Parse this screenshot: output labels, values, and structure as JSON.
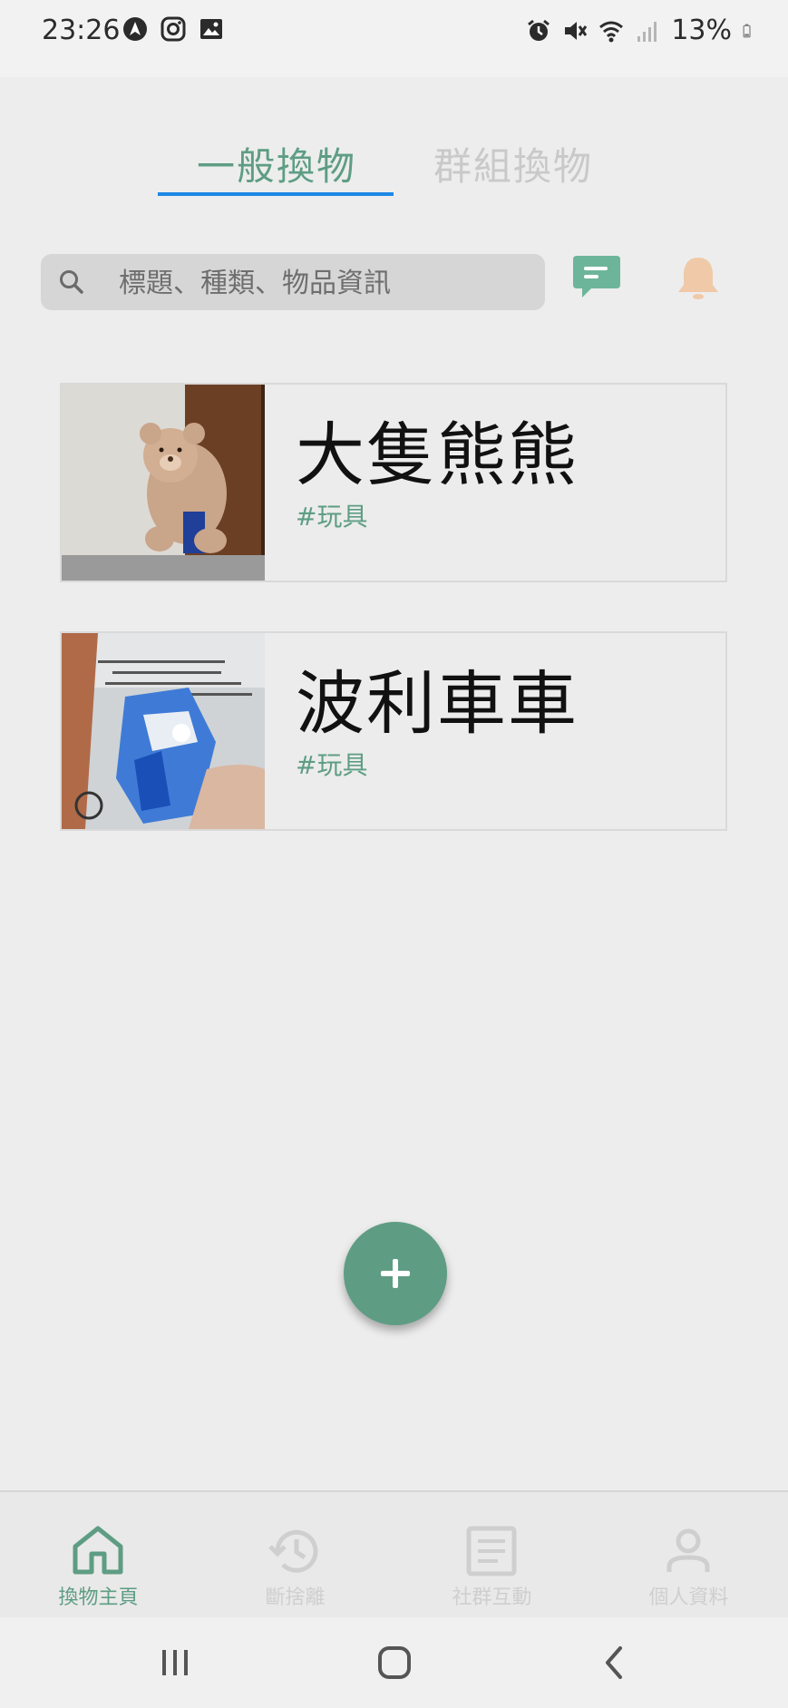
{
  "status": {
    "time": "23:26",
    "battery": "13%",
    "left_icons": [
      "navigation-app-icon",
      "instagram-icon",
      "gallery-icon"
    ],
    "right_icons": [
      "alarm-icon",
      "mute-icon",
      "wifi-icon",
      "signal-icon",
      "battery-icon"
    ]
  },
  "tabs": [
    {
      "label": "一般換物",
      "active": true
    },
    {
      "label": "群組換物",
      "active": false
    }
  ],
  "search": {
    "placeholder": "標題、種類、物品資訊",
    "value": ""
  },
  "items": [
    {
      "title": "大隻熊熊",
      "tag": "#玩具",
      "photo": "teddy-bear-photo"
    },
    {
      "title": "波利車車",
      "tag": "#玩具",
      "photo": "toy-robot-car-photo"
    }
  ],
  "bottom_nav": [
    {
      "label": "換物主頁",
      "icon": "home-icon",
      "active": true
    },
    {
      "label": "斷捨離",
      "icon": "history-icon",
      "active": false
    },
    {
      "label": "社群互動",
      "icon": "article-icon",
      "active": false
    },
    {
      "label": "個人資料",
      "icon": "person-icon",
      "active": false
    }
  ],
  "colors": {
    "accent": "#5e9d84",
    "tab_indicator": "#1e88e5",
    "bell": "#f0c9a8",
    "inactive": "#cfcfcf",
    "background": "#ededed"
  }
}
